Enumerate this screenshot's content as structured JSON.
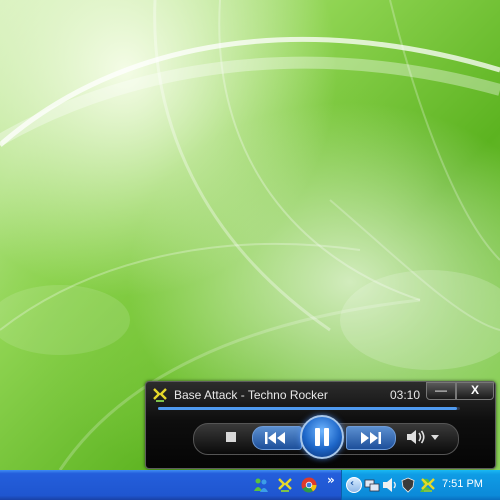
{
  "player": {
    "track_title": "Base Attack - Techno Rocker",
    "time": "03:10",
    "minimize_label": "—",
    "close_label": "X",
    "progress_fraction": 0.99,
    "icons": {
      "logo": "media-player-logo-icon",
      "stop": "stop-icon",
      "previous": "previous-track-icon",
      "pause": "pause-icon",
      "next": "next-track-icon",
      "volume": "volume-icon"
    },
    "accent_color": "#4f9af0"
  },
  "taskbar": {
    "chevron": "»",
    "clock": "7:51 PM",
    "quicklaunch_icons": [
      "messenger-icon",
      "media-player-icon",
      "chrome-icon"
    ],
    "tray_icons": [
      "network-icon",
      "volume-tray-icon",
      "security-icon",
      "user-icon",
      "media-player-tray-icon"
    ]
  }
}
